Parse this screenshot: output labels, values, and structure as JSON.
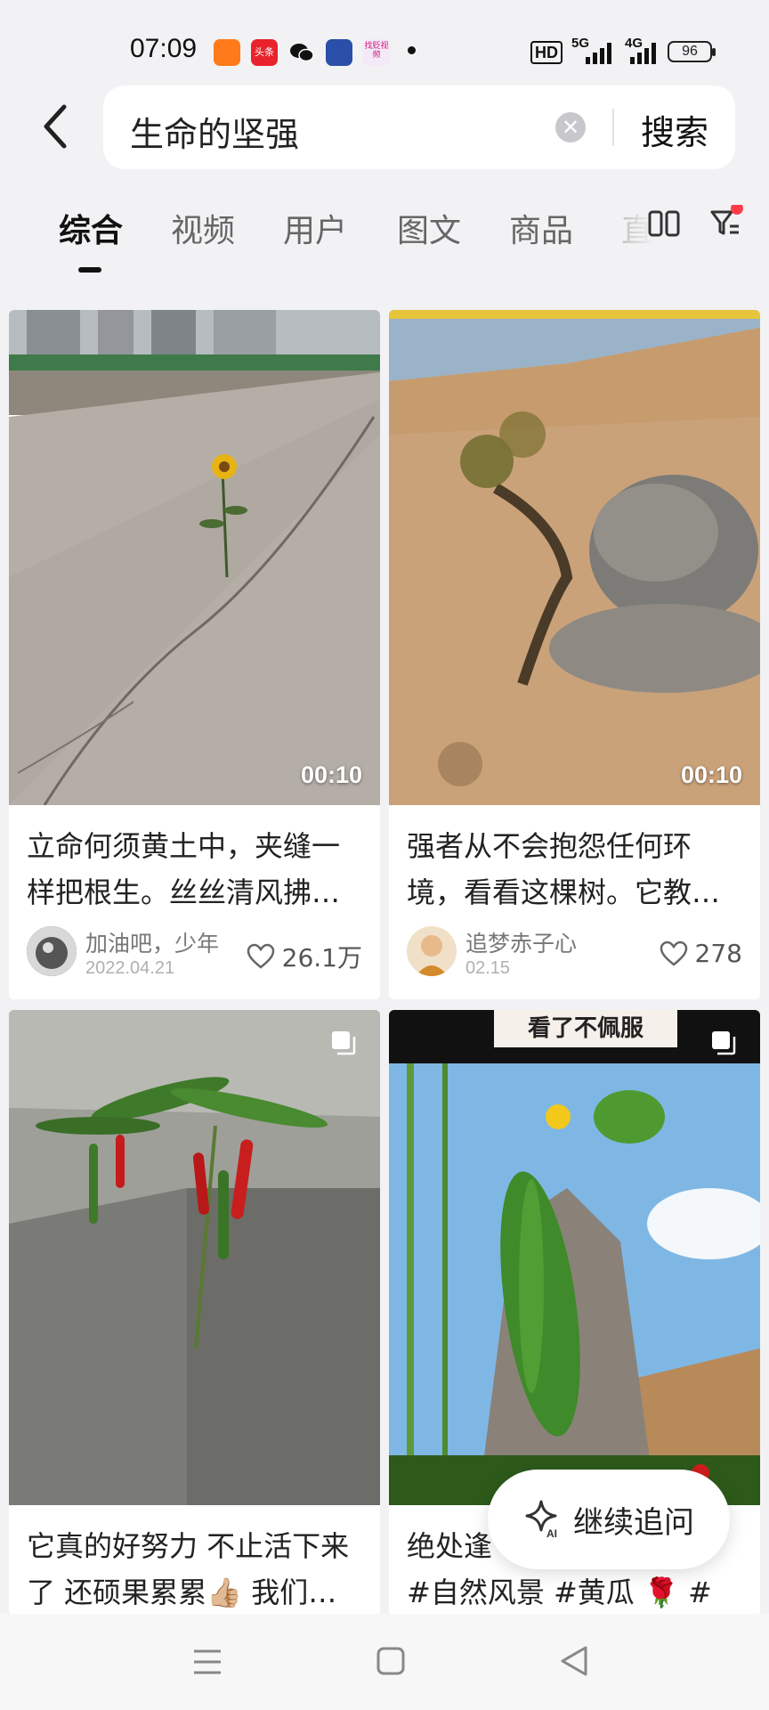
{
  "status_bar": {
    "time": "07:09",
    "battery": "96",
    "network_1": "5G",
    "network_2": "4G",
    "hd": "HD",
    "notif_toutiao": "头条",
    "notif_wechat_label": "wechat",
    "notif_app": "找贬视频"
  },
  "search": {
    "query": "生命的坚强",
    "button_label": "搜索"
  },
  "tabs": [
    {
      "label": "综合",
      "active": true
    },
    {
      "label": "视频"
    },
    {
      "label": "用户"
    },
    {
      "label": "图文"
    },
    {
      "label": "商品"
    },
    {
      "label": "直"
    }
  ],
  "cards": [
    {
      "caption": "立命何须黄土中，夹缝一样把根生。丝丝清风拂…",
      "author": "加油吧，少年",
      "date": "2022.04.21",
      "likes": "26.1万",
      "duration": "00:10",
      "image": "sunflower-on-road"
    },
    {
      "caption": "强者从不会抱怨任何环境，看看这棵树。它教…",
      "author": "追梦赤子心",
      "date": "02.15",
      "likes": "278",
      "duration": "00:10",
      "image": "tree-under-boulder"
    },
    {
      "caption": "它真的好努力 不止活下来了 还硕果累累👍🏼 我们…",
      "image": "chili-plant-on-steps"
    },
    {
      "caption_line1": "绝处逢",
      "caption_line2": "#自然风景 #黄瓜 🌹 #",
      "overlay_text": "看了不佩服",
      "image": "cucumber-on-rock"
    }
  ],
  "ai_button": {
    "label": "继续追问",
    "icon_text": "AI"
  },
  "colors": {
    "background": "#f2f2f4",
    "card": "#ffffff",
    "text": "#222222",
    "accent_dot": "#ff3b4a"
  }
}
